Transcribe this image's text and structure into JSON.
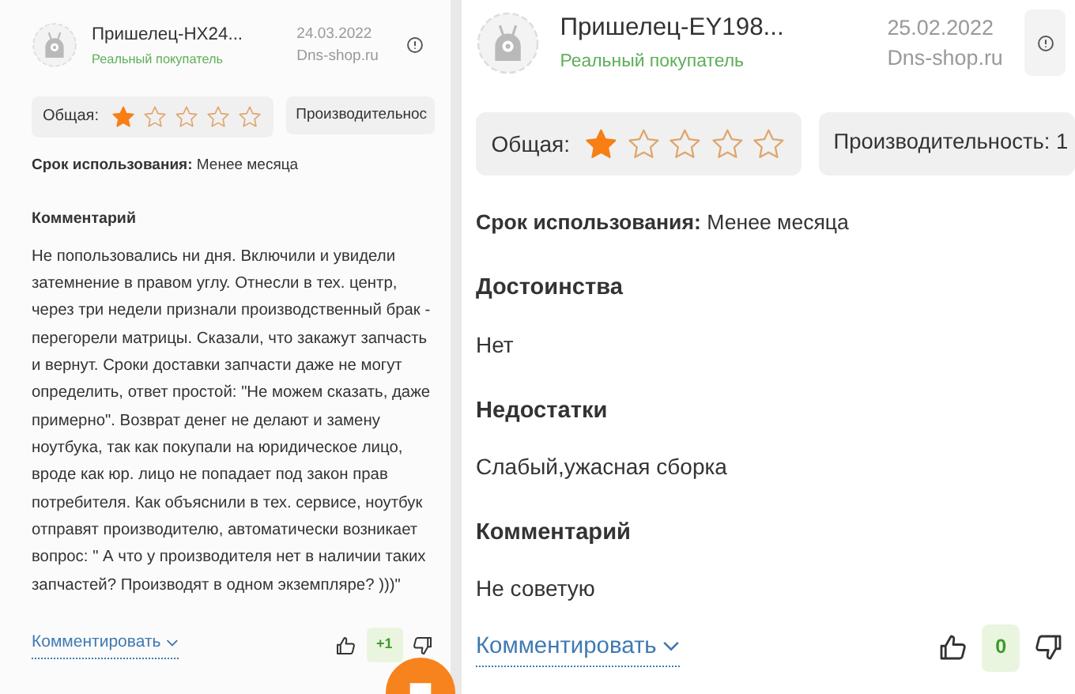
{
  "reviews": [
    {
      "author": "Пришелец-HX24...",
      "badge": "Реальный покупатель",
      "date": "24.03.2022",
      "source": "Dns-shop.ru",
      "overall_label": "Общая:",
      "stars": 1,
      "performance_label": "Производительнос",
      "usage_label": "Срок использования:",
      "usage_value": "Менее месяца",
      "sections": [
        {
          "heading": "Комментарий",
          "text": "Не попользовались ни дня. Включили и увидели затемнение в правом углу. Отнесли в тех. центр, через три недели признали производственный брак - перегорели матрицы. Сказали, что закажут запчасть и вернут. Сроки доставки запчасти даже не могут определить, ответ простой: \"Не можем сказать, даже примерно\". Возврат денег не делают и замену ноутбука, так как покупали на юридическое лицо, вроде как юр. лицо не попадает под закон прав потребителя. Как объяснили в тех. сервисе, ноутбук отправят производителю, автоматически возникает вопрос: \" А что у производителя нет в наличии таких запчастей? Производят в одном экземпляре? )))\""
        }
      ],
      "comment_link": "Комментировать",
      "votes": "+1"
    },
    {
      "author": "Пришелец-EY198...",
      "badge": "Реальный покупатель",
      "date": "25.02.2022",
      "source": "Dns-shop.ru",
      "overall_label": "Общая:",
      "stars": 1,
      "performance_label": "Производительность: 1",
      "usage_label": "Срок использования:",
      "usage_value": "Менее месяца",
      "sections": [
        {
          "heading": "Достоинства",
          "text": "Нет"
        },
        {
          "heading": "Недостатки",
          "text": "Слабый,ужасная сборка"
        },
        {
          "heading": "Комментарий",
          "text": "Не советую"
        }
      ],
      "comment_link": "Комментировать",
      "votes": "0"
    }
  ],
  "chat_button": {
    "kind": "floating"
  }
}
